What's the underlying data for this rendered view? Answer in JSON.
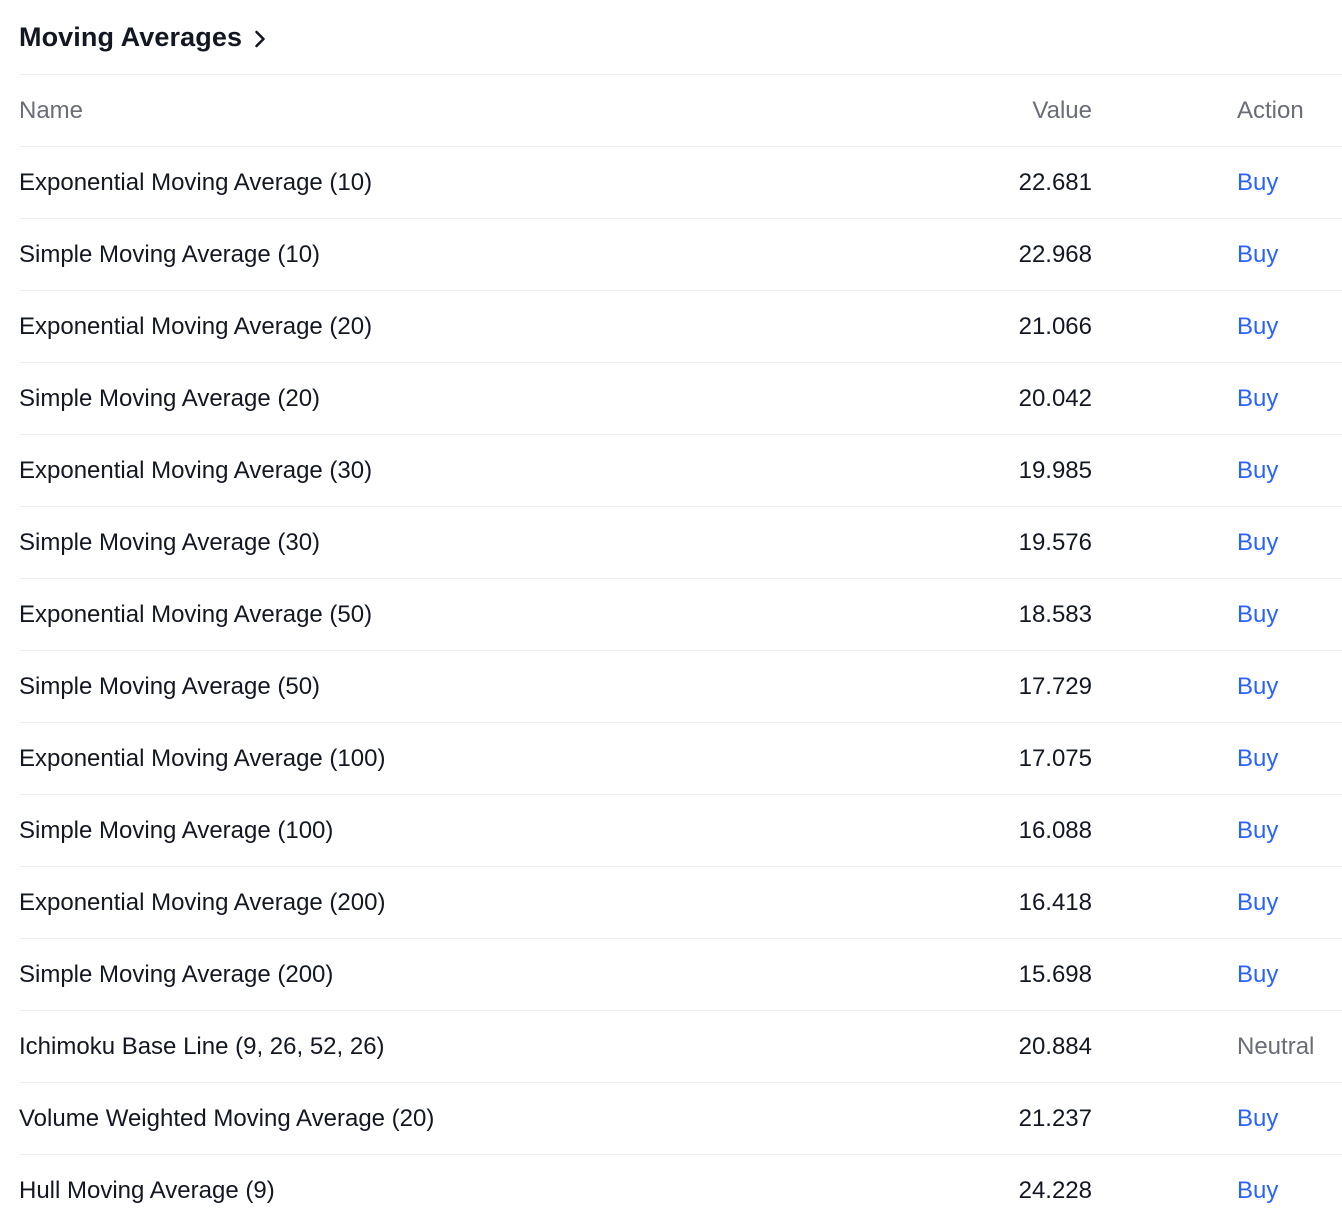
{
  "section": {
    "title": "Moving Averages",
    "chevron_icon": "chevron-right-icon"
  },
  "table": {
    "headers": {
      "name": "Name",
      "value": "Value",
      "action": "Action"
    },
    "rows": [
      {
        "name": "Exponential Moving Average (10)",
        "value": "22.681",
        "action": "Buy"
      },
      {
        "name": "Simple Moving Average (10)",
        "value": "22.968",
        "action": "Buy"
      },
      {
        "name": "Exponential Moving Average (20)",
        "value": "21.066",
        "action": "Buy"
      },
      {
        "name": "Simple Moving Average (20)",
        "value": "20.042",
        "action": "Buy"
      },
      {
        "name": "Exponential Moving Average (30)",
        "value": "19.985",
        "action": "Buy"
      },
      {
        "name": "Simple Moving Average (30)",
        "value": "19.576",
        "action": "Buy"
      },
      {
        "name": "Exponential Moving Average (50)",
        "value": "18.583",
        "action": "Buy"
      },
      {
        "name": "Simple Moving Average (50)",
        "value": "17.729",
        "action": "Buy"
      },
      {
        "name": "Exponential Moving Average (100)",
        "value": "17.075",
        "action": "Buy"
      },
      {
        "name": "Simple Moving Average (100)",
        "value": "16.088",
        "action": "Buy"
      },
      {
        "name": "Exponential Moving Average (200)",
        "value": "16.418",
        "action": "Buy"
      },
      {
        "name": "Simple Moving Average (200)",
        "value": "15.698",
        "action": "Buy"
      },
      {
        "name": "Ichimoku Base Line (9, 26, 52, 26)",
        "value": "20.884",
        "action": "Neutral"
      },
      {
        "name": "Volume Weighted Moving Average (20)",
        "value": "21.237",
        "action": "Buy"
      },
      {
        "name": "Hull Moving Average (9)",
        "value": "24.228",
        "action": "Buy"
      }
    ]
  },
  "colors": {
    "text": "#131722",
    "muted": "#6a6d78",
    "buy": "#2962ff",
    "divider": "#eceef2"
  }
}
